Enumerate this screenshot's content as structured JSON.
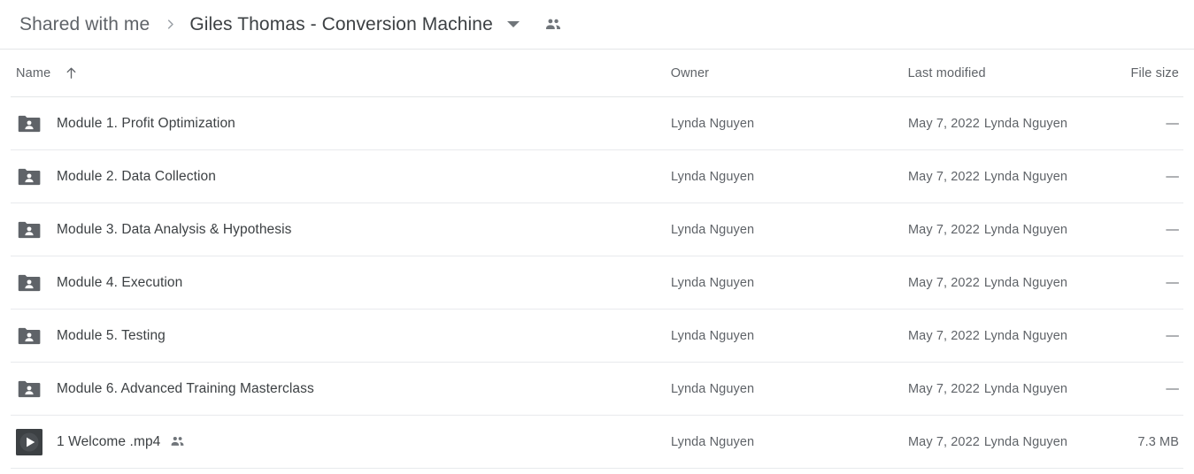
{
  "breadcrumb": {
    "root_label": "Shared with me",
    "separator_icon": "chevron-right-icon",
    "current_label": "Giles Thomas - Conversion Machine",
    "caret_icon": "chevron-down-icon",
    "people_icon": "people-shared-icon"
  },
  "table": {
    "columns": {
      "name": "Name",
      "sort_icon": "arrow-up-icon",
      "owner": "Owner",
      "modified": "Last modified",
      "size": "File size"
    },
    "rows": [
      {
        "icon": "shared-folder-icon",
        "name": "Module 1. Profit Optimization",
        "shared_icon": "",
        "owner": "Lynda Nguyen",
        "modified_date": "May 7, 2022",
        "modified_by": "Lynda Nguyen",
        "size": "—"
      },
      {
        "icon": "shared-folder-icon",
        "name": "Module 2. Data Collection",
        "shared_icon": "",
        "owner": "Lynda Nguyen",
        "modified_date": "May 7, 2022",
        "modified_by": "Lynda Nguyen",
        "size": "—"
      },
      {
        "icon": "shared-folder-icon",
        "name": "Module 3. Data Analysis & Hypothesis",
        "shared_icon": "",
        "owner": "Lynda Nguyen",
        "modified_date": "May 7, 2022",
        "modified_by": "Lynda Nguyen",
        "size": "—"
      },
      {
        "icon": "shared-folder-icon",
        "name": "Module 4. Execution",
        "shared_icon": "",
        "owner": "Lynda Nguyen",
        "modified_date": "May 7, 2022",
        "modified_by": "Lynda Nguyen",
        "size": "—"
      },
      {
        "icon": "shared-folder-icon",
        "name": "Module 5. Testing",
        "shared_icon": "",
        "owner": "Lynda Nguyen",
        "modified_date": "May 7, 2022",
        "modified_by": "Lynda Nguyen",
        "size": "—"
      },
      {
        "icon": "shared-folder-icon",
        "name": "Module 6. Advanced Training Masterclass",
        "shared_icon": "",
        "owner": "Lynda Nguyen",
        "modified_date": "May 7, 2022",
        "modified_by": "Lynda Nguyen",
        "size": "—"
      },
      {
        "icon": "video-file-icon",
        "name": "1 Welcome .mp4",
        "shared_icon": "people-shared-icon",
        "owner": "Lynda Nguyen",
        "modified_date": "May 7, 2022",
        "modified_by": "Lynda Nguyen",
        "size": "7.3 MB"
      }
    ]
  },
  "colors": {
    "text_primary": "#3c4043",
    "text_secondary": "#5f6368",
    "divider": "#e8eaed",
    "folder_icon": "#5f6368",
    "video_icon_bg": "#3c4043",
    "background": "#ffffff"
  }
}
